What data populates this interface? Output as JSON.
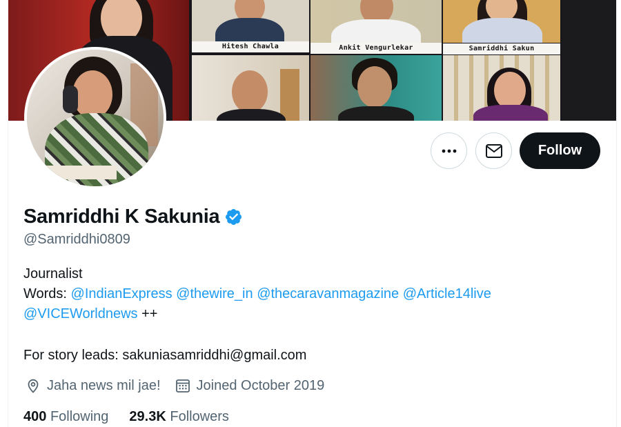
{
  "banner": {
    "participants": [
      {
        "name": "Hitesh Chawla"
      },
      {
        "name": "Ankit Vengurlekar"
      },
      {
        "name": "Samriddhi Sakun"
      }
    ]
  },
  "profile": {
    "display_name": "Samriddhi K Sakunia",
    "handle": "@Samriddhi0809",
    "verified_icon": "verified-badge-icon",
    "accent_color": "#1d9bf0",
    "bio": {
      "line1": "Journalist",
      "words_label": "Words:",
      "mentions_line2": [
        "@IndianExpress",
        "@thewire_in",
        "@thecaravanmagazine",
        "@Article14live"
      ],
      "mention_line3": "@VICEWorldnews",
      "suffix": "++",
      "story_leads": "For story leads: sakuniasamriddhi@gmail.com"
    },
    "location": "Jaha news mil jae!",
    "joined": "Joined October 2019",
    "following_count": "400",
    "following_label": "Following",
    "followers_count": "29.3K",
    "followers_label": "Followers"
  },
  "actions": {
    "more_icon": "more-dots-icon",
    "message_icon": "envelope-icon",
    "follow_label": "Follow"
  }
}
